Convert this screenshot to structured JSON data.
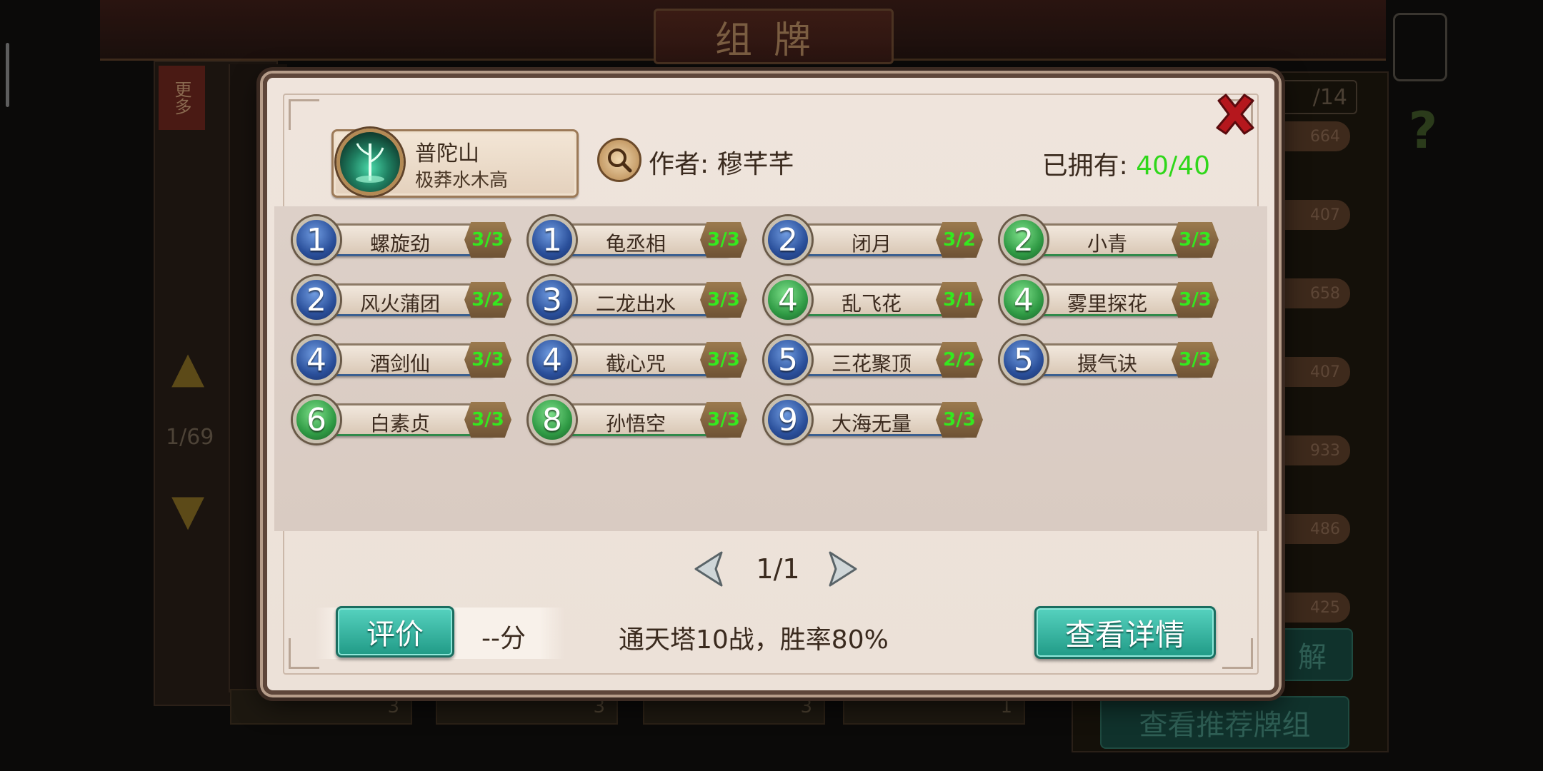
{
  "background": {
    "title": "组牌",
    "more_tag": "更多",
    "count_label": "1/69",
    "page_counter": "/14",
    "card_counts": [
      "664",
      "407",
      "658",
      "407",
      "933",
      "486",
      "425"
    ],
    "bottom_card_counts": [
      "3",
      "3",
      "3",
      "1"
    ],
    "side_button": "解",
    "recommend_button": "查看推荐牌组"
  },
  "modal": {
    "deck_name": "普陀山",
    "deck_subtitle": "极莽水木高",
    "author_label": "作者: 穆芊芊",
    "owned_label": "已拥有: ",
    "owned_value": "40/40",
    "cards": [
      {
        "cost": "1",
        "name": "螺旋劲",
        "count": "3/3",
        "color": "blue"
      },
      {
        "cost": "1",
        "name": "龟丞相",
        "count": "3/3",
        "color": "blue"
      },
      {
        "cost": "2",
        "name": "闭月",
        "count": "3/2",
        "color": "blue"
      },
      {
        "cost": "2",
        "name": "小青",
        "count": "3/3",
        "color": "green"
      },
      {
        "cost": "2",
        "name": "风火蒲团",
        "count": "3/2",
        "color": "blue"
      },
      {
        "cost": "3",
        "name": "二龙出水",
        "count": "3/3",
        "color": "blue"
      },
      {
        "cost": "4",
        "name": "乱飞花",
        "count": "3/1",
        "color": "green"
      },
      {
        "cost": "4",
        "name": "雾里探花",
        "count": "3/3",
        "color": "green"
      },
      {
        "cost": "4",
        "name": "酒剑仙",
        "count": "3/3",
        "color": "blue"
      },
      {
        "cost": "4",
        "name": "截心咒",
        "count": "3/3",
        "color": "blue"
      },
      {
        "cost": "5",
        "name": "三花聚顶",
        "count": "2/2",
        "color": "blue"
      },
      {
        "cost": "5",
        "name": "摄气诀",
        "count": "3/3",
        "color": "blue"
      },
      {
        "cost": "6",
        "name": "白素贞",
        "count": "3/3",
        "color": "green"
      },
      {
        "cost": "8",
        "name": "孙悟空",
        "count": "3/3",
        "color": "green"
      },
      {
        "cost": "9",
        "name": "大海无量",
        "count": "3/3",
        "color": "blue"
      }
    ],
    "page_label": "1/1",
    "rate_button": "评价",
    "score": "--分",
    "record": "通天塔10战，胜率80%",
    "detail_button": "查看详情"
  },
  "colors": {
    "owned_green": "#2fd71a",
    "button_teal": "#209a86",
    "close_red": "#b5171d"
  },
  "icons": [
    "close-icon",
    "search-icon",
    "chevron-left-icon",
    "chevron-right-icon",
    "bamboo-emblem-icon"
  ]
}
